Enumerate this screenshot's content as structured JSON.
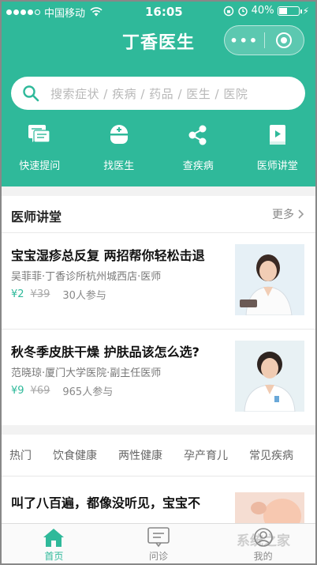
{
  "status_bar": {
    "carrier": "中国移动",
    "time": "16:05",
    "battery": "40%",
    "battery_level": 0.4
  },
  "header": {
    "title": "丁香医生",
    "more_label": "•••"
  },
  "search": {
    "placeholder": "搜索症状 / 疾病 / 药品 / 医生 / 医院"
  },
  "quick_actions": [
    {
      "label": "快速提问",
      "icon": "chat-bubble-icon"
    },
    {
      "label": "找医生",
      "icon": "doctor-icon"
    },
    {
      "label": "查疾病",
      "icon": "share-nodes-icon"
    },
    {
      "label": "医师讲堂",
      "icon": "video-book-icon"
    }
  ],
  "lecture_section": {
    "title": "医师讲堂",
    "more_label": "更多",
    "courses": [
      {
        "title": "宝宝湿疹总反复 两招帮你轻松击退",
        "doctor": "吴菲菲·丁香诊所杭州城西店·医师",
        "price": "¥2",
        "original_price": "¥39",
        "participants": "30人参与"
      },
      {
        "title": "秋冬季皮肤干燥 护肤品该怎么选?",
        "doctor": "范晓琼·厦门大学医院·副主任医师",
        "price": "¥9",
        "original_price": "¥69",
        "participants": "965人参与"
      }
    ]
  },
  "category_tabs": [
    "热门",
    "饮食健康",
    "两性健康",
    "孕产育儿",
    "常见疾病"
  ],
  "article": {
    "title": "叫了八百遍，都像没听见，宝宝不"
  },
  "tab_bar": [
    {
      "label": "首页",
      "icon": "home-icon",
      "active": true
    },
    {
      "label": "问诊",
      "icon": "consult-icon",
      "active": false
    },
    {
      "label": "我的",
      "icon": "profile-icon",
      "active": false
    }
  ],
  "colors": {
    "brand": "#2fb99a",
    "price": "#2fb99a"
  },
  "watermark": "系统之家"
}
